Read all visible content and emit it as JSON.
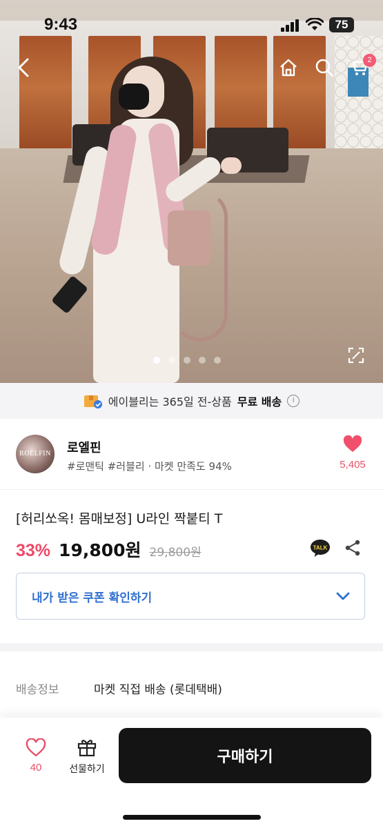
{
  "status_bar": {
    "time": "9:43",
    "battery": "75"
  },
  "hero": {
    "cart_badge": "2",
    "carousel": {
      "total": 5,
      "active": 0
    }
  },
  "shipping_banner": {
    "text_prefix": "에이블리는 365일 전-상품",
    "text_bold": "무료 배송"
  },
  "seller": {
    "avatar_text": "ROELFIN",
    "name": "로엘핀",
    "meta": "#로맨틱 #러블리 · 마켓 만족도 94%",
    "favorite_count": "5,405"
  },
  "product": {
    "title": "[허리쏘옥! 몸매보정] U라인 짝붙티 T",
    "discount": "33%",
    "price": "19,800원",
    "original_price": "29,800원"
  },
  "coupon": {
    "label": "내가 받은 쿠폰 확인하기"
  },
  "delivery": {
    "key": "배송정보",
    "value": "마켓 직접 배송 (롯데택배)"
  },
  "bottom_bar": {
    "like_count": "40",
    "gift_label": "선물하기",
    "buy_label": "구매하기"
  },
  "colors": {
    "accent_pink": "#ef4968",
    "coupon_blue": "#2f6fd0",
    "buy_button": "#141414"
  }
}
